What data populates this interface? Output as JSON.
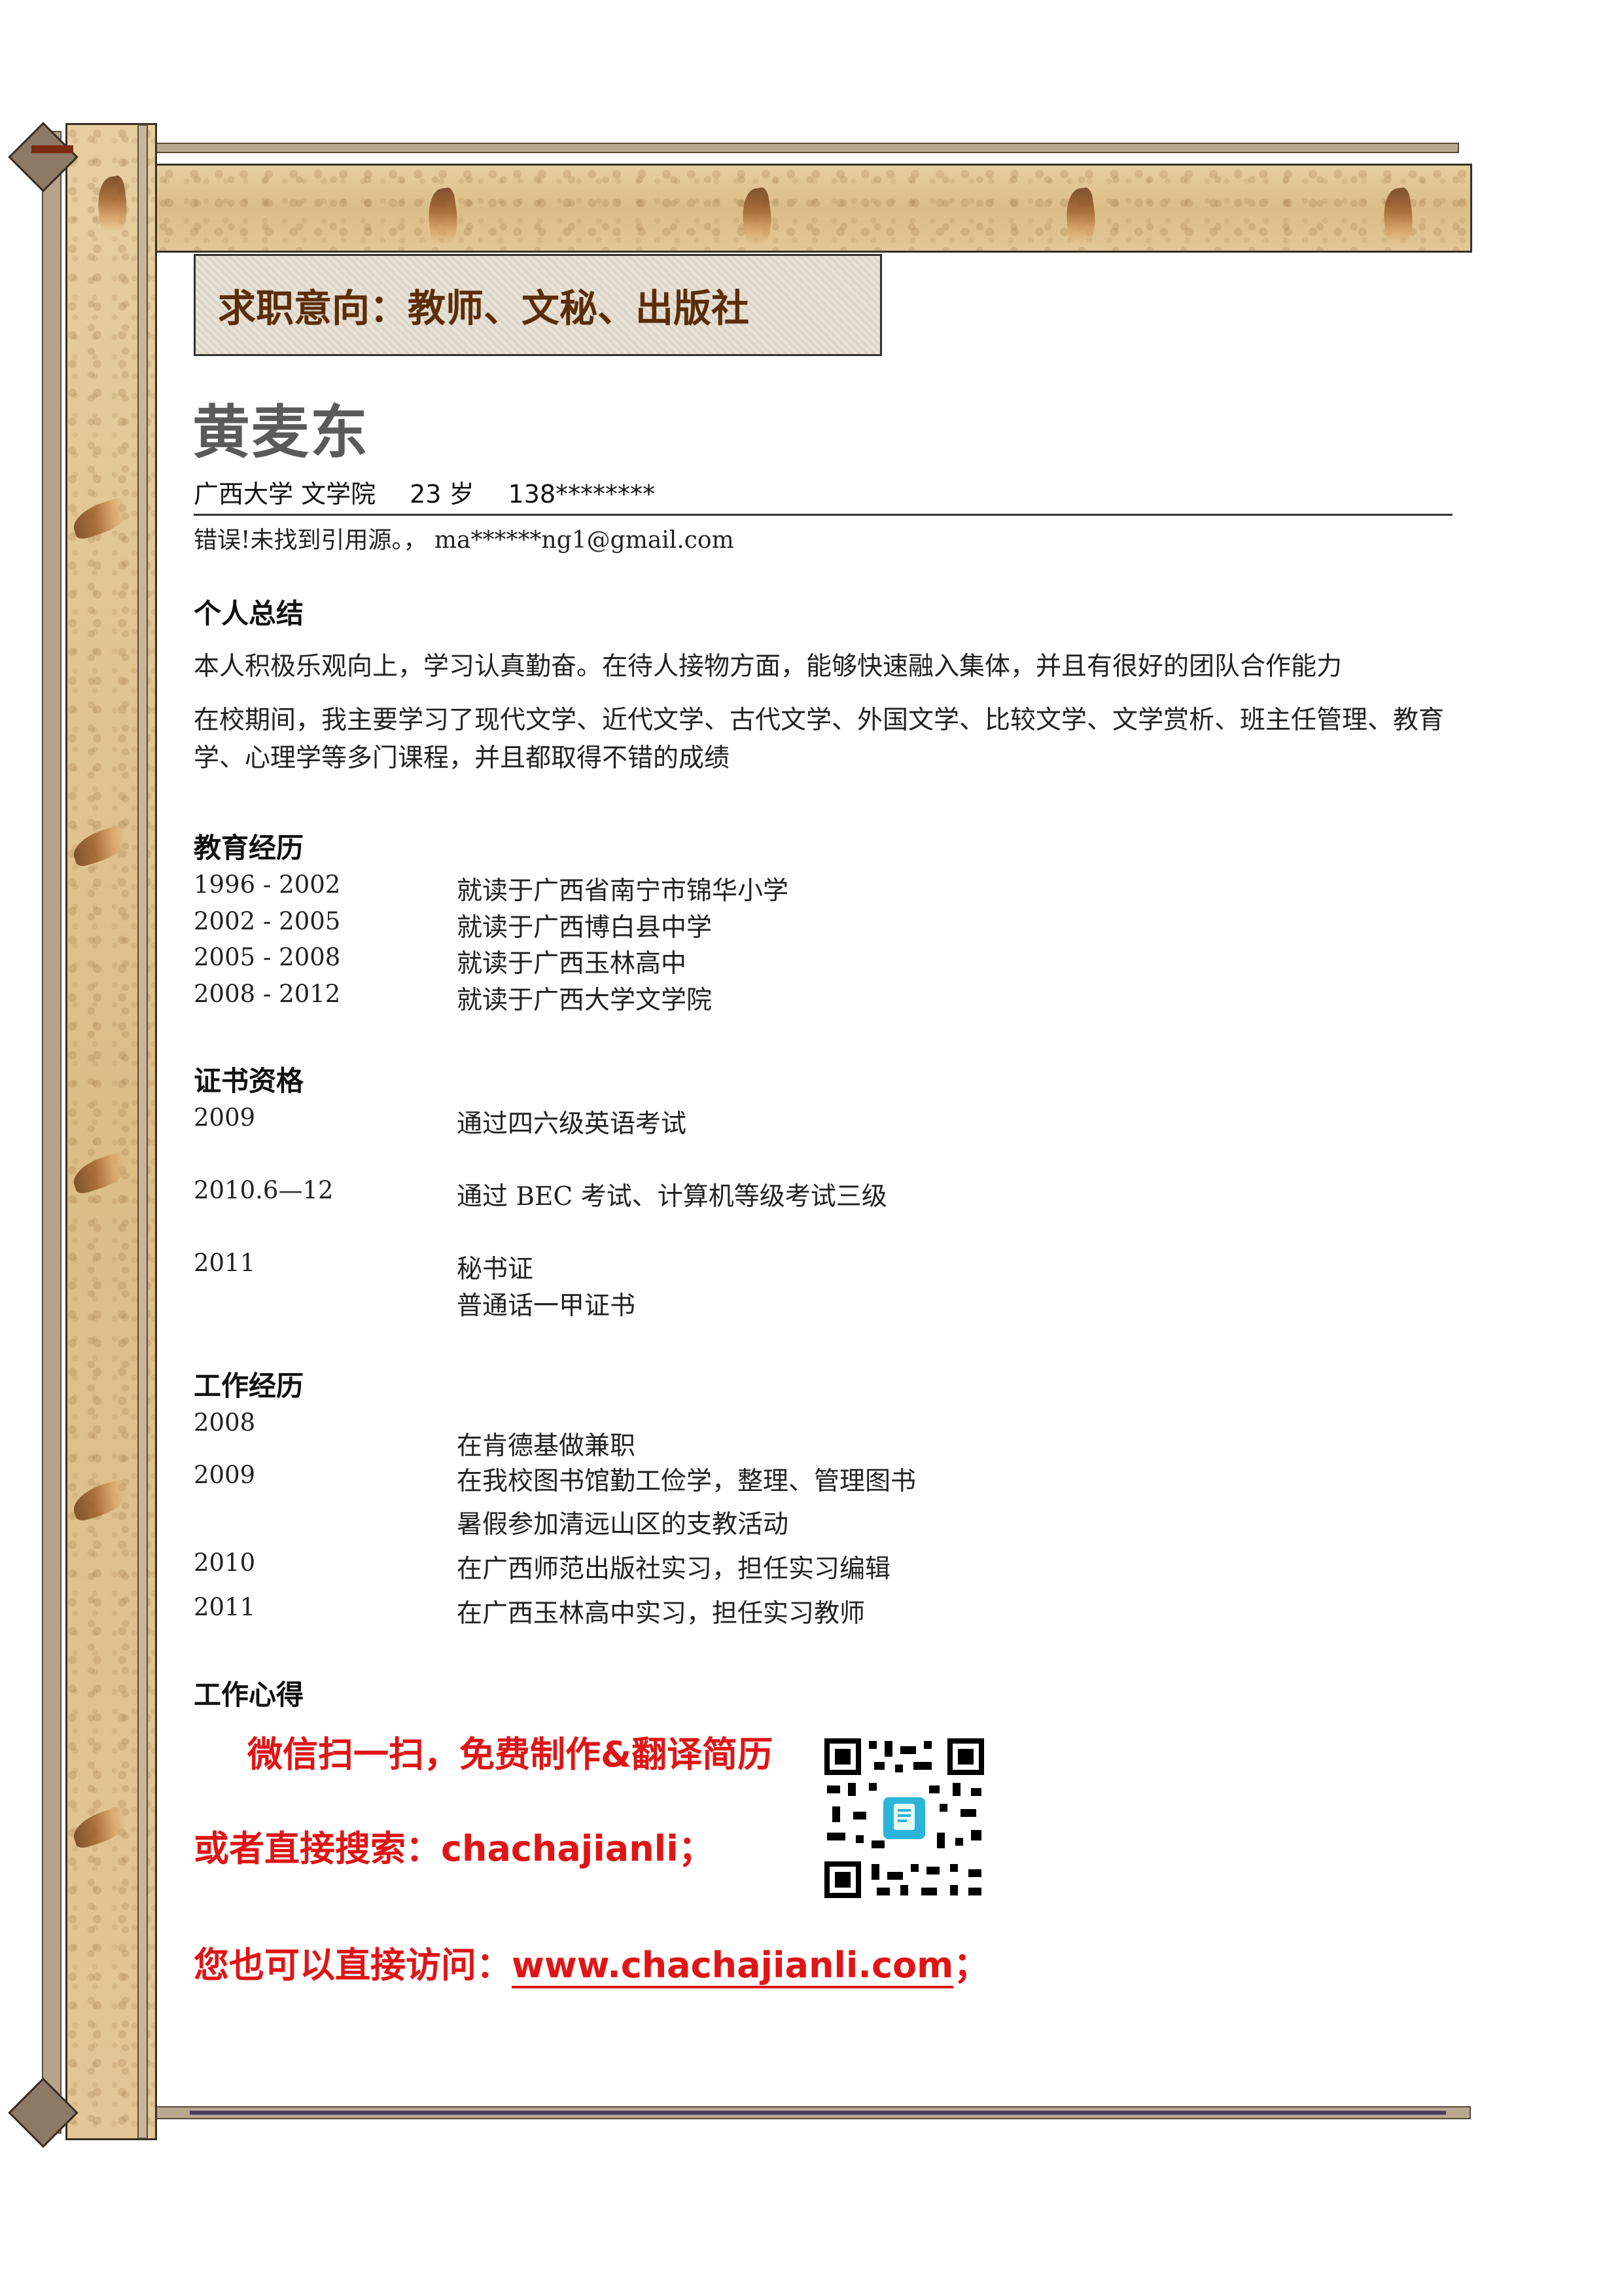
{
  "banner": {
    "text": "求职意向：教师、文秘、出版社"
  },
  "person": {
    "name": "黄麦东",
    "school": "广西大学 文学院",
    "age": "23 岁",
    "phone": "138********",
    "contact_line": "错误!未找到引用源。， ma******ng1@gmail.com"
  },
  "sections": {
    "summary": {
      "title": "个人总结",
      "p1": "本人积极乐观向上，学习认真勤奋。在待人接物方面，能够快速融入集体，并且有很好的团队合作能力",
      "p2": "在校期间，我主要学习了现代文学、近代文学、古代文学、外国文学、比较文学、文学赏析、班主任管理、教育学、心理学等多门课程，并且都取得不错的成绩"
    },
    "education": {
      "title": "教育经历",
      "rows": [
        {
          "years": "1996 - 2002",
          "desc": "就读于广西省南宁市锦华小学"
        },
        {
          "years": "2002 - 2005",
          "desc": "就读于广西博白县中学"
        },
        {
          "years": "2005 - 2008",
          "desc": "就读于广西玉林高中"
        },
        {
          "years": "2008 - 2012",
          "desc": "就读于广西大学文学院"
        }
      ]
    },
    "certificates": {
      "title": "证书资格",
      "rows": [
        {
          "years": "2009",
          "desc": "通过四六级英语考试"
        },
        {
          "years": "2010.6—12",
          "desc": "通过 BEC 考试、计算机等级考试三级"
        },
        {
          "years": "2011",
          "desc": "秘书证",
          "desc2": "普通话一甲证书"
        }
      ]
    },
    "work": {
      "title": "工作经历",
      "rows": [
        {
          "years": "2008",
          "desc": "在肯德基做兼职"
        },
        {
          "years": "2009",
          "desc": "在我校图书馆勤工俭学，整理、管理图书",
          "desc2": "暑假参加清远山区的支教活动"
        },
        {
          "years": "2010",
          "desc": "在广西师范出版社实习，担任实习编辑"
        },
        {
          "years": "2011",
          "desc": "在广西玉林高中实习，担任实习教师"
        }
      ]
    },
    "insight": {
      "title": "工作心得"
    }
  },
  "promo": {
    "line1": "微信扫一扫，免费制作&翻译简历",
    "line2": "或者直接搜索：chachajianli；",
    "line3_prefix": "您也可以直接访问：",
    "line3_link": "www.chachajianli.com",
    "line3_suffix": "；"
  }
}
